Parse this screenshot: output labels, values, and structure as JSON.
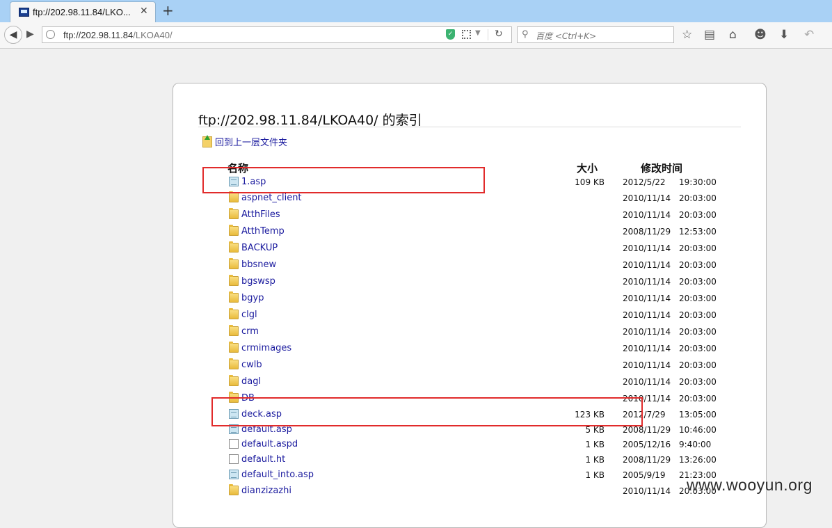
{
  "browser": {
    "tab_title": "ftp://202.98.11.84/LKO...",
    "tab_close": "✕",
    "new_tab": "+",
    "url_host": "ftp://202.98.11.84",
    "url_path": "/LKOA40/",
    "search_placeholder": "百度 <Ctrl+K>"
  },
  "page": {
    "title": "ftp://202.98.11.84/LKOA40/ 的索引",
    "up_link": "回到上一层文件夹",
    "headers": {
      "name": "名称",
      "size": "大小",
      "modified": "修改时间"
    },
    "rows": [
      {
        "icon": "asp",
        "name": "1.asp",
        "size": "109 KB",
        "date": "2012/5/22",
        "time": "19:30:00"
      },
      {
        "icon": "folder",
        "name": "aspnet_client",
        "size": "",
        "date": "2010/11/14",
        "time": "20:03:00"
      },
      {
        "icon": "folder",
        "name": "AtthFiles",
        "size": "",
        "date": "2010/11/14",
        "time": "20:03:00"
      },
      {
        "icon": "folder",
        "name": "AtthTemp",
        "size": "",
        "date": "2008/11/29",
        "time": "12:53:00"
      },
      {
        "icon": "folder",
        "name": "BACKUP",
        "size": "",
        "date": "2010/11/14",
        "time": "20:03:00"
      },
      {
        "icon": "folder",
        "name": "bbsnew",
        "size": "",
        "date": "2010/11/14",
        "time": "20:03:00"
      },
      {
        "icon": "folder",
        "name": "bgswsp",
        "size": "",
        "date": "2010/11/14",
        "time": "20:03:00"
      },
      {
        "icon": "folder",
        "name": "bgyp",
        "size": "",
        "date": "2010/11/14",
        "time": "20:03:00"
      },
      {
        "icon": "folder",
        "name": "clgl",
        "size": "",
        "date": "2010/11/14",
        "time": "20:03:00"
      },
      {
        "icon": "folder",
        "name": "crm",
        "size": "",
        "date": "2010/11/14",
        "time": "20:03:00"
      },
      {
        "icon": "folder",
        "name": "crmimages",
        "size": "",
        "date": "2010/11/14",
        "time": "20:03:00"
      },
      {
        "icon": "folder",
        "name": "cwlb",
        "size": "",
        "date": "2010/11/14",
        "time": "20:03:00"
      },
      {
        "icon": "folder",
        "name": "dagl",
        "size": "",
        "date": "2010/11/14",
        "time": "20:03:00"
      },
      {
        "icon": "folder",
        "name": "DB",
        "size": "",
        "date": "2010/11/14",
        "time": "20:03:00"
      },
      {
        "icon": "asp",
        "name": "deck.asp",
        "size": "123 KB",
        "date": "2012/7/29",
        "time": "13:05:00"
      },
      {
        "icon": "asp",
        "name": "default.asp",
        "size": "5 KB",
        "date": "2008/11/29",
        "time": "10:46:00"
      },
      {
        "icon": "file",
        "name": "default.aspd",
        "size": "1 KB",
        "date": "2005/12/16",
        "time": "9:40:00"
      },
      {
        "icon": "file",
        "name": "default.ht",
        "size": "1 KB",
        "date": "2008/11/29",
        "time": "13:26:00"
      },
      {
        "icon": "asp",
        "name": "default_into.asp",
        "size": "1 KB",
        "date": "2005/9/19",
        "time": "21:23:00"
      },
      {
        "icon": "folder",
        "name": "dianzizazhi",
        "size": "",
        "date": "2010/11/14",
        "time": "20:03:00"
      }
    ]
  },
  "watermark": "www.wooyun.org",
  "colors": {
    "highlight": "#e12b2b",
    "link": "#1a1a9e",
    "tabbar": "#a9d1f5"
  }
}
